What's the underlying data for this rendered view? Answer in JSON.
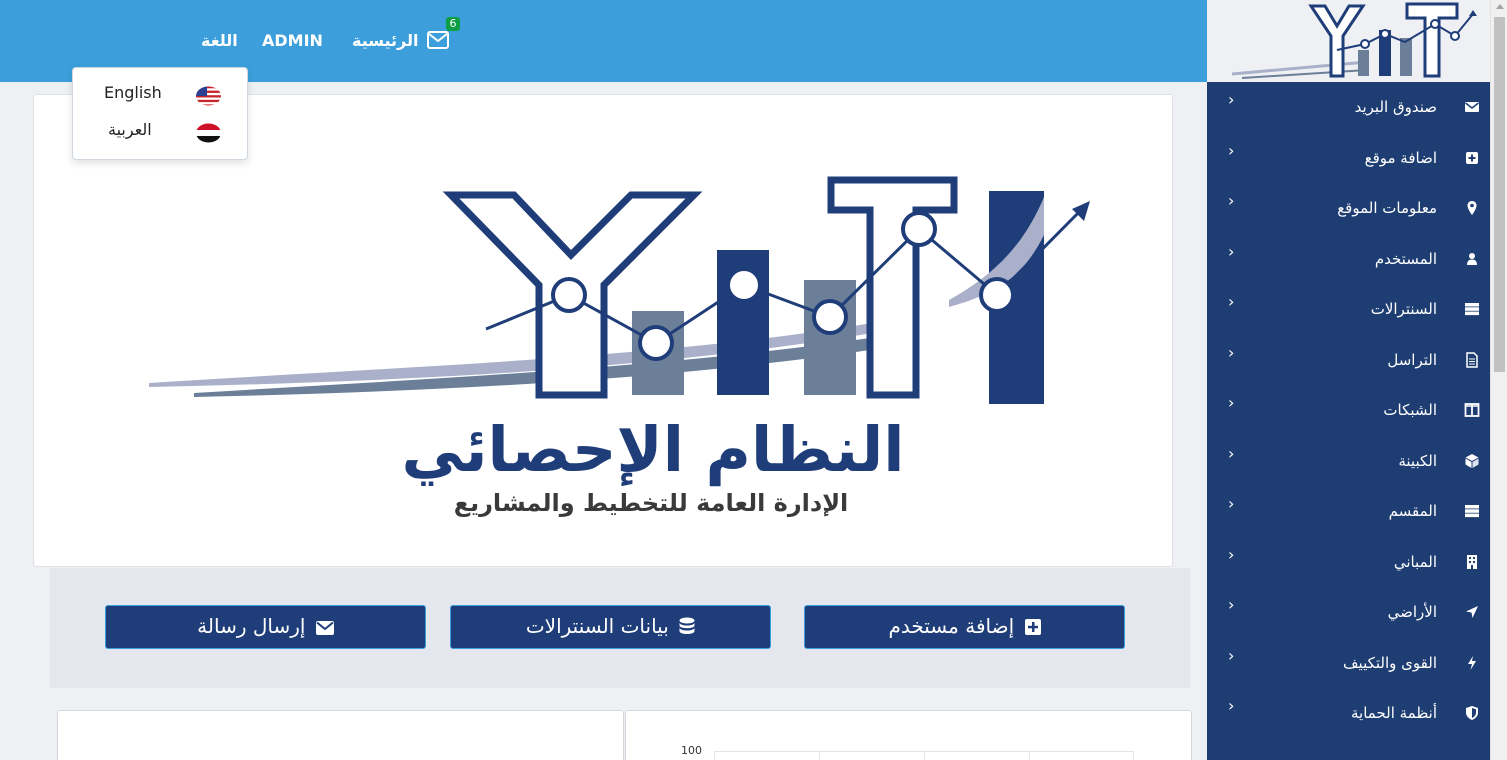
{
  "topbar": {
    "language_label": "اللغة",
    "user_label": "ADMIN",
    "home_label": "الرئيسية",
    "mail_badge": "6",
    "mail_icon": "envelope-icon",
    "background_color": "#3c9fdb"
  },
  "language_menu": {
    "options": [
      {
        "label": "English",
        "flag": "us-flag-icon"
      },
      {
        "label": "العربية",
        "flag": "yemen-flag-icon"
      }
    ]
  },
  "sidebar": {
    "background_color": "#1e3d73",
    "items": [
      {
        "label": "صندوق البريد",
        "icon": "envelope-icon"
      },
      {
        "label": "اضافة موقع",
        "icon": "plus-square-icon"
      },
      {
        "label": "معلومات الموقع",
        "icon": "map-marker-icon"
      },
      {
        "label": "المستخدم",
        "icon": "user-icon"
      },
      {
        "label": "السنترالات",
        "icon": "server-icon"
      },
      {
        "label": "التراسل",
        "icon": "document-icon"
      },
      {
        "label": "الشبكات",
        "icon": "columns-icon"
      },
      {
        "label": "الكبينة",
        "icon": "cube-icon"
      },
      {
        "label": "المقسم",
        "icon": "server-icon"
      },
      {
        "label": "المباني",
        "icon": "building-icon"
      },
      {
        "label": "الأراضي",
        "icon": "location-arrow-icon"
      },
      {
        "label": "القوى والتكييف",
        "icon": "bolt-icon"
      },
      {
        "label": "أنظمة الحماية",
        "icon": "shield-icon"
      }
    ]
  },
  "banner": {
    "title": "النظام الإحصائي",
    "subtitle": "الإدارة العامة للتخطيط والمشاريع",
    "colors": {
      "dark": "#1f3d79",
      "mid": "#6b7f99",
      "light": "#aab0c9"
    }
  },
  "actions": {
    "add_user": "إضافة مستخدم",
    "servers_data": "بيانات السنترالات",
    "send_message": "إرسال رسالة",
    "button_color": "#1f3d79"
  },
  "chart": {
    "y_tick_top": "100"
  }
}
